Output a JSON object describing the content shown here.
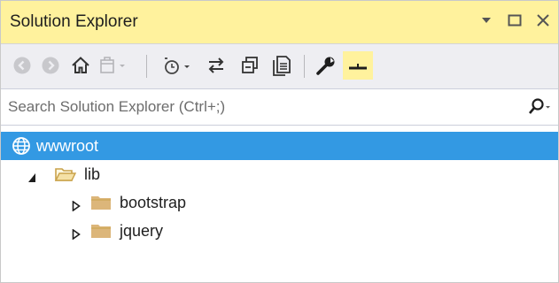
{
  "window": {
    "title": "Solution Explorer",
    "colors": {
      "titlebar": "#fff29d",
      "toolbar": "#eeeef2",
      "selection": "#3399e3"
    },
    "controls": [
      "dropdown-arrow-icon",
      "maximize-icon",
      "close-icon"
    ]
  },
  "toolbar": {
    "buttons": [
      {
        "name": "back-button",
        "icon": "back-arrow-icon",
        "enabled": false
      },
      {
        "name": "forward-button",
        "icon": "forward-arrow-icon",
        "enabled": false
      },
      {
        "name": "home-button",
        "icon": "home-icon",
        "enabled": true
      },
      {
        "name": "switch-views-button",
        "icon": "switch-views-icon",
        "enabled": false
      },
      {
        "name": "pending-changes-filter-button",
        "icon": "clock-icon",
        "enabled": true
      },
      {
        "name": "sync-with-active-document-button",
        "icon": "sync-arrows-icon",
        "enabled": true
      },
      {
        "name": "collapse-all-button",
        "icon": "collapse-all-icon",
        "enabled": true
      },
      {
        "name": "show-all-files-button",
        "icon": "show-all-files-icon",
        "enabled": true
      },
      {
        "name": "properties-button",
        "icon": "wrench-icon",
        "enabled": true
      },
      {
        "name": "preview-selected-items-button",
        "icon": "preview-icon",
        "enabled": true,
        "active": true
      }
    ]
  },
  "search": {
    "placeholder": "Search Solution Explorer (Ctrl+;)",
    "value": ""
  },
  "tree": {
    "items": [
      {
        "label": "wwwroot",
        "icon": "globe-icon",
        "selected": true,
        "expander": "none"
      },
      {
        "label": "lib",
        "icon": "folder-open-icon",
        "selected": false,
        "expander": "expanded"
      },
      {
        "label": "bootstrap",
        "icon": "folder-icon",
        "selected": false,
        "expander": "collapsed"
      },
      {
        "label": "jquery",
        "icon": "folder-icon",
        "selected": false,
        "expander": "collapsed"
      }
    ]
  }
}
